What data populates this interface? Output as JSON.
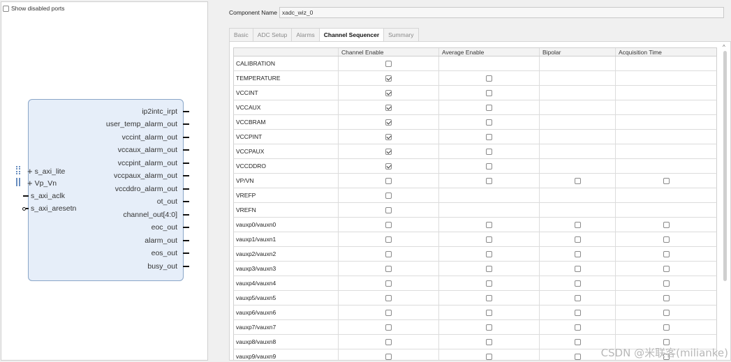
{
  "left": {
    "show_disabled_label": "Show disabled ports",
    "output_ports": [
      "ip2intc_irpt",
      "user_temp_alarm_out",
      "vccint_alarm_out",
      "vccaux_alarm_out",
      "vccpint_alarm_out",
      "vccpaux_alarm_out",
      "vccddro_alarm_out",
      "ot_out",
      "channel_out[4:0]",
      "eoc_out",
      "alarm_out",
      "eos_out",
      "busy_out"
    ],
    "input_ports": {
      "axi_lite": "s_axi_lite",
      "vp_vn": "Vp_Vn",
      "aclk": "s_axi_aclk",
      "aresetn": "s_axi_aresetn"
    }
  },
  "right": {
    "component_name_label": "Component Name",
    "component_name_value": "xadc_wiz_0",
    "tabs": [
      "Basic",
      "ADC Setup",
      "Alarms",
      "Channel Sequencer",
      "Summary"
    ],
    "active_tab": "Channel Sequencer",
    "table": {
      "headers": [
        "",
        "Channel Enable",
        "Average Enable",
        "Bipolar",
        "Acquisition Time"
      ],
      "rows": [
        {
          "name": "CALIBRATION",
          "ce": false,
          "ae": null,
          "bp": null,
          "at": null
        },
        {
          "name": "TEMPERATURE",
          "ce": true,
          "ae": false,
          "bp": null,
          "at": null
        },
        {
          "name": "VCCINT",
          "ce": true,
          "ae": false,
          "bp": null,
          "at": null
        },
        {
          "name": "VCCAUX",
          "ce": true,
          "ae": false,
          "bp": null,
          "at": null
        },
        {
          "name": "VCCBRAM",
          "ce": true,
          "ae": false,
          "bp": null,
          "at": null
        },
        {
          "name": "VCCPINT",
          "ce": true,
          "ae": false,
          "bp": null,
          "at": null
        },
        {
          "name": "VCCPAUX",
          "ce": true,
          "ae": false,
          "bp": null,
          "at": null
        },
        {
          "name": "VCCDDRO",
          "ce": true,
          "ae": false,
          "bp": null,
          "at": null
        },
        {
          "name": "VP/VN",
          "ce": false,
          "ae": false,
          "bp": false,
          "at": false
        },
        {
          "name": "VREFP",
          "ce": false,
          "ae": null,
          "bp": null,
          "at": null
        },
        {
          "name": "VREFN",
          "ce": false,
          "ae": null,
          "bp": null,
          "at": null
        },
        {
          "name": "vauxp0/vauxn0",
          "ce": false,
          "ae": false,
          "bp": false,
          "at": false
        },
        {
          "name": "vauxp1/vauxn1",
          "ce": false,
          "ae": false,
          "bp": false,
          "at": false
        },
        {
          "name": "vauxp2/vauxn2",
          "ce": false,
          "ae": false,
          "bp": false,
          "at": false
        },
        {
          "name": "vauxp3/vauxn3",
          "ce": false,
          "ae": false,
          "bp": false,
          "at": false
        },
        {
          "name": "vauxp4/vauxn4",
          "ce": false,
          "ae": false,
          "bp": false,
          "at": false
        },
        {
          "name": "vauxp5/vauxn5",
          "ce": false,
          "ae": false,
          "bp": false,
          "at": false
        },
        {
          "name": "vauxp6/vauxn6",
          "ce": false,
          "ae": false,
          "bp": false,
          "at": false
        },
        {
          "name": "vauxp7/vauxn7",
          "ce": false,
          "ae": false,
          "bp": false,
          "at": false
        },
        {
          "name": "vauxp8/vauxn8",
          "ce": false,
          "ae": false,
          "bp": false,
          "at": false
        },
        {
          "name": "vauxp9/vauxn9",
          "ce": false,
          "ae": false,
          "bp": false,
          "at": false
        }
      ]
    }
  },
  "watermark": "CSDN @米联客(milianke)"
}
